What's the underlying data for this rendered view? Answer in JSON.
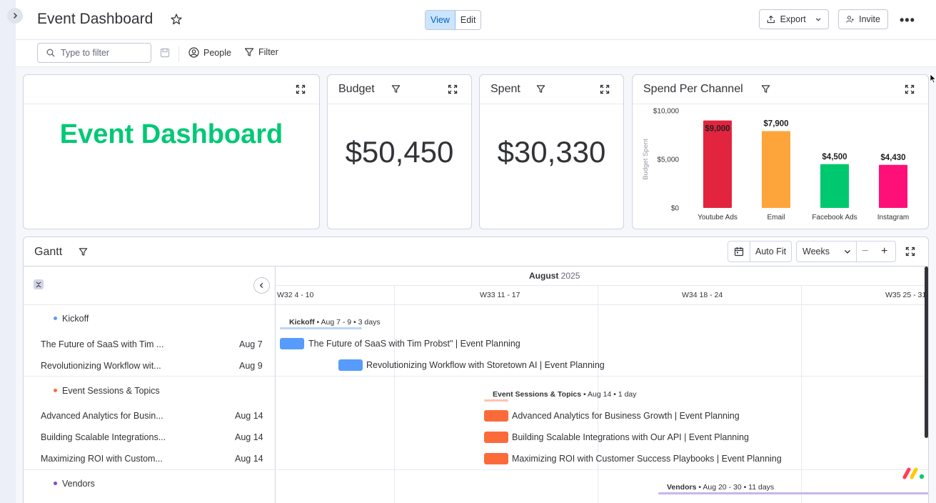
{
  "header": {
    "title": "Event Dashboard",
    "view_label": "View",
    "edit_label": "Edit",
    "export_label": "Export",
    "invite_label": "Invite"
  },
  "filterbar": {
    "search_placeholder": "Type to filter",
    "people_label": "People",
    "filter_label": "Filter"
  },
  "widgets": {
    "brand_title": "Event Dashboard",
    "budget": {
      "title": "Budget",
      "value": "$50,450"
    },
    "spent": {
      "title": "Spent",
      "value": "$30,330"
    },
    "channel": {
      "title": "Spend Per Channel"
    }
  },
  "chart_data": {
    "type": "bar",
    "title": "Spend Per Channel",
    "ylabel": "Budget Spent",
    "xlabel": "",
    "categories": [
      "Youtube Ads",
      "Email",
      "Facebook Ads",
      "Instagram"
    ],
    "values": [
      9000,
      7900,
      4500,
      4430
    ],
    "value_labels": [
      "$9,000",
      "$7,900",
      "$4,500",
      "$4,430"
    ],
    "colors": [
      "#e2243f",
      "#fda43a",
      "#00c86f",
      "#ff0f78"
    ],
    "ylim": [
      0,
      10000
    ],
    "yticks": [
      0,
      5000,
      10000
    ],
    "ytick_labels": [
      "$0",
      "$5,000",
      "$10,000"
    ],
    "grid": false
  },
  "gantt": {
    "title": "Gantt",
    "autofit_label": "Auto Fit",
    "scale_label": "Weeks",
    "month_bold": "August",
    "month_year": "2025",
    "weeks": [
      "W32 4 - 10",
      "W33 11 - 17",
      "W34 18 - 24",
      "W35 25 - 31"
    ],
    "groups": [
      {
        "name": "Kickoff",
        "color": "#579bfc",
        "bar_name": "Kickoff",
        "bar_meta": " • Aug 7 - 9 • 3 days",
        "items": [
          {
            "name": "The Future of SaaS with Tim ...",
            "date": "Aug 7",
            "bar_label": "The Future of SaaS with Tim Probst\" | Event Planning"
          },
          {
            "name": "Revolutionizing Workflow wit...",
            "date": "Aug 9",
            "bar_label": "Revolutionizing Workflow with Storetown AI | Event Planning"
          }
        ]
      },
      {
        "name": "Event Sessions & Topics",
        "color": "#fb6b3a",
        "bar_name": "Event Sessions & Topics",
        "bar_meta": " • Aug 14 • 1 day",
        "items": [
          {
            "name": "Advanced Analytics for Busin...",
            "date": "Aug 14",
            "bar_label": "Advanced Analytics for Business Growth | Event Planning"
          },
          {
            "name": "Building Scalable Integrations...",
            "date": "Aug 14",
            "bar_label": "Building Scalable Integrations with Our API | Event Planning"
          },
          {
            "name": "Maximizing ROI with Custom...",
            "date": "Aug 14",
            "bar_label": "Maximizing ROI with Customer Success Playbooks | Event Planning"
          }
        ]
      },
      {
        "name": "Vendors",
        "color": "#784bd1",
        "bar_name": "Vendors",
        "bar_meta": " • Aug 20 - 30 • 11 days",
        "items": []
      }
    ]
  }
}
